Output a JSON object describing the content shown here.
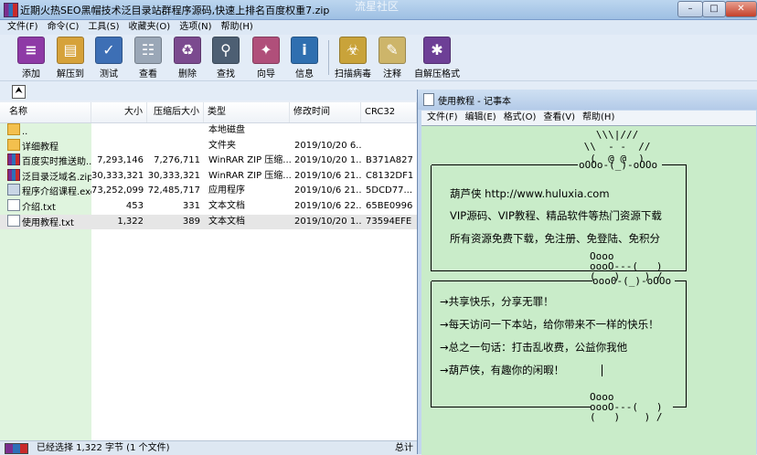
{
  "rar": {
    "title": "近期火热SEO黑帽技术泛目录站群程序源码,快速上排名百度权重7.zip",
    "watermark": "流星社区",
    "caption_buttons": {
      "minimize": "–",
      "maximize": "□",
      "close": "✕"
    },
    "menu": [
      "文件(F)",
      "命令(C)",
      "工具(S)",
      "收藏夹(O)",
      "选项(N)",
      "帮助(H)"
    ],
    "toolbar": [
      {
        "label": "添加",
        "icon": "add-archive-icon",
        "color": "#8e3aa6",
        "glyph": "≡"
      },
      {
        "label": "解压到",
        "icon": "extract-folder-icon",
        "color": "#d6a23a",
        "glyph": "▤"
      },
      {
        "label": "测试",
        "icon": "test-archive-icon",
        "color": "#3d6fb5",
        "glyph": "✓"
      },
      {
        "label": "查看",
        "icon": "view-book-icon",
        "color": "#9aa7b7",
        "glyph": "☷"
      },
      {
        "label": "删除",
        "icon": "delete-icon",
        "color": "#7b4a8f",
        "glyph": "♻"
      },
      {
        "label": "查找",
        "icon": "find-binoculars-icon",
        "color": "#4d5f73",
        "glyph": "⚲"
      },
      {
        "label": "向导",
        "icon": "wizard-icon",
        "color": "#b04f7a",
        "glyph": "✦"
      },
      {
        "label": "信息",
        "icon": "info-icon",
        "color": "#2f6fb0",
        "glyph": "i"
      },
      {
        "label": "扫描病毒",
        "icon": "virus-scan-icon",
        "color": "#c9a33a",
        "glyph": "☣"
      },
      {
        "label": "注释",
        "icon": "comment-icon",
        "color": "#cdb56a",
        "glyph": "✎"
      },
      {
        "label": "自解压格式",
        "icon": "sfx-icon",
        "color": "#6d3f96",
        "glyph": "✱"
      }
    ],
    "up_button": "⮝",
    "columns": [
      "名称",
      "大小",
      "压缩后大小",
      "类型",
      "修改时间",
      "CRC32"
    ],
    "rows": [
      {
        "icon": "folder",
        "name": "..",
        "size": "",
        "packed": "",
        "type": "本地磁盘",
        "modified": "",
        "crc": ""
      },
      {
        "icon": "folder",
        "name": "详细教程",
        "size": "",
        "packed": "",
        "type": "文件夹",
        "modified": "2019/10/20 6...",
        "crc": ""
      },
      {
        "icon": "zip",
        "name": "百度实时推送助...",
        "size": "7,293,146",
        "packed": "7,276,711",
        "type": "WinRAR ZIP 压缩...",
        "modified": "2019/10/20 1...",
        "crc": "B371A827"
      },
      {
        "icon": "zip",
        "name": "泛目录泛域名.zip",
        "size": "30,333,321",
        "packed": "30,333,321",
        "type": "WinRAR ZIP 压缩...",
        "modified": "2019/10/6 21...",
        "crc": "C8132DF1"
      },
      {
        "icon": "exe",
        "name": "程序介绍课程.exe",
        "size": "73,252,099",
        "packed": "72,485,717",
        "type": "应用程序",
        "modified": "2019/10/6 21...",
        "crc": "5DCD77..."
      },
      {
        "icon": "txt",
        "name": "介绍.txt",
        "size": "453",
        "packed": "331",
        "type": "文本文档",
        "modified": "2019/10/6 22...",
        "crc": "65BE0996"
      },
      {
        "icon": "txt",
        "name": "使用教程.txt",
        "size": "1,322",
        "packed": "389",
        "type": "文本文档",
        "modified": "2019/10/20 1...",
        "crc": "73594EFE",
        "selected": true
      }
    ],
    "status": {
      "text": "已经选择 1,322 字节 (1 个文件)",
      "total": "总计"
    }
  },
  "notepad": {
    "title": "使用教程 - 记事本",
    "menu": [
      "文件(F)",
      "编辑(E)",
      "格式(O)",
      "查看(V)",
      "帮助(H)"
    ],
    "art_top": "           \\\\\\|///\n         \\\\  - -  //\n          (  @ @  )",
    "box1_top": "oOOo-(_)-oOOo",
    "box1_lines": [
      "葫芦侠   http://www.huluxia.com",
      "VIP源码、VIP教程、精品软件等热门资源下载",
      "所有资源免费下载，免注册、免登陆、免积分"
    ],
    "box1_bottom": "ooo0-(_)-oOOo",
    "mid_art": "Oooo\noooO---(   )\n(   )    ) /",
    "box2_lines": [
      "→共享快乐，分享无罪！",
      "→每天访问一下本站，给你带来不一样的快乐！",
      "→总之一句话：打击乱收费，公益你我他",
      "→葫芦侠，有趣你的闲暇！"
    ],
    "bottom_art": "Oooo\noooO---(   )\n(   )    ) /"
  }
}
